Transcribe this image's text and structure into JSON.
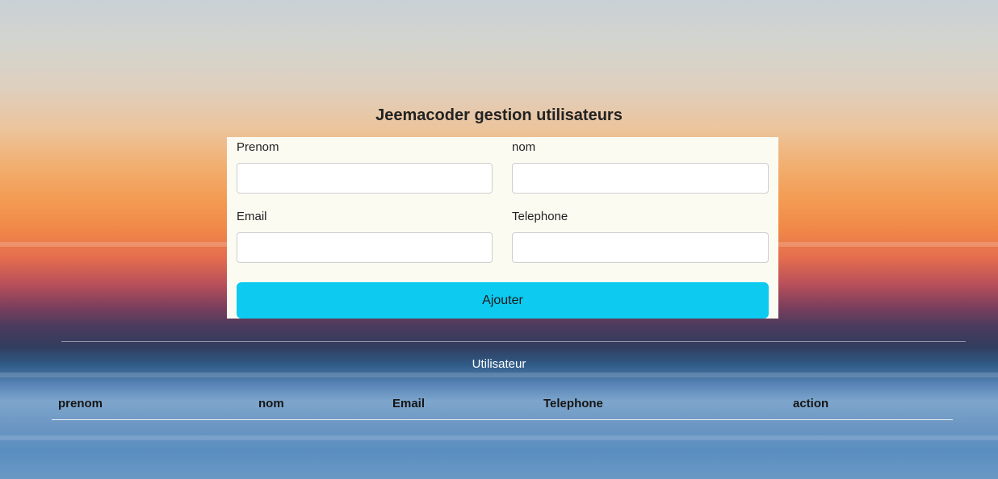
{
  "header": {
    "title": "Jeemacoder gestion utilisateurs"
  },
  "form": {
    "fields": [
      {
        "label": "Prenom",
        "value": "",
        "placeholder": ""
      },
      {
        "label": "nom",
        "value": "",
        "placeholder": ""
      },
      {
        "label": "Email",
        "value": "",
        "placeholder": ""
      },
      {
        "label": "Telephone",
        "value": "",
        "placeholder": ""
      }
    ],
    "submit_label": "Ajouter"
  },
  "users_section": {
    "caption": "Utilisateur",
    "columns": [
      "prenom",
      "nom",
      "Email",
      "Telephone",
      "action"
    ],
    "rows": []
  },
  "colors": {
    "form_background": "#fcfbf2",
    "submit_button": "#0dcaf0"
  }
}
